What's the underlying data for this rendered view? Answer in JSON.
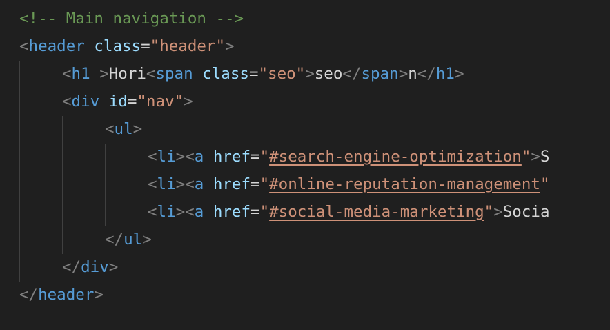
{
  "comment": "<!-- Main navigation -->",
  "lines": [
    {
      "indent": 0,
      "tokens": [
        {
          "t": "<",
          "c": "tag-bracket"
        },
        {
          "t": "header",
          "c": "tag"
        },
        {
          "t": " ",
          "c": "text"
        },
        {
          "t": "class",
          "c": "attr"
        },
        {
          "t": "=",
          "c": "eq"
        },
        {
          "t": "\"header\"",
          "c": "str"
        },
        {
          "t": ">",
          "c": "tag-bracket"
        }
      ]
    },
    {
      "indent": 1,
      "tokens": [
        {
          "t": "<",
          "c": "tag-bracket"
        },
        {
          "t": "h1",
          "c": "tag"
        },
        {
          "t": " ",
          "c": "text"
        },
        {
          "t": ">",
          "c": "tag-bracket"
        },
        {
          "t": "Hori",
          "c": "text"
        },
        {
          "t": "<",
          "c": "tag-bracket"
        },
        {
          "t": "span",
          "c": "tag"
        },
        {
          "t": " ",
          "c": "text"
        },
        {
          "t": "class",
          "c": "attr"
        },
        {
          "t": "=",
          "c": "eq"
        },
        {
          "t": "\"seo\"",
          "c": "str"
        },
        {
          "t": ">",
          "c": "tag-bracket"
        },
        {
          "t": "seo",
          "c": "text"
        },
        {
          "t": "</",
          "c": "tag-bracket"
        },
        {
          "t": "span",
          "c": "tag"
        },
        {
          "t": ">",
          "c": "tag-bracket"
        },
        {
          "t": "n",
          "c": "text"
        },
        {
          "t": "</",
          "c": "tag-bracket"
        },
        {
          "t": "h1",
          "c": "tag"
        },
        {
          "t": ">",
          "c": "tag-bracket"
        }
      ]
    },
    {
      "indent": 1,
      "tokens": [
        {
          "t": "<",
          "c": "tag-bracket"
        },
        {
          "t": "div",
          "c": "tag"
        },
        {
          "t": " ",
          "c": "text"
        },
        {
          "t": "id",
          "c": "attr"
        },
        {
          "t": "=",
          "c": "eq"
        },
        {
          "t": "\"nav\"",
          "c": "str"
        },
        {
          "t": ">",
          "c": "tag-bracket"
        }
      ]
    },
    {
      "indent": 2,
      "tokens": [
        {
          "t": "<",
          "c": "tag-bracket"
        },
        {
          "t": "ul",
          "c": "tag"
        },
        {
          "t": ">",
          "c": "tag-bracket"
        }
      ]
    },
    {
      "indent": 3,
      "tokens": [
        {
          "t": "<",
          "c": "tag-bracket"
        },
        {
          "t": "li",
          "c": "tag"
        },
        {
          "t": ">",
          "c": "tag-bracket"
        },
        {
          "t": "<",
          "c": "tag-bracket"
        },
        {
          "t": "a",
          "c": "tag"
        },
        {
          "t": " ",
          "c": "text"
        },
        {
          "t": "href",
          "c": "attr"
        },
        {
          "t": "=",
          "c": "eq"
        },
        {
          "t": "\"",
          "c": "str"
        },
        {
          "t": "#search-engine-optimization",
          "c": "link"
        },
        {
          "t": "\"",
          "c": "str"
        },
        {
          "t": ">",
          "c": "tag-bracket"
        },
        {
          "t": "S",
          "c": "text"
        }
      ]
    },
    {
      "indent": 3,
      "tokens": [
        {
          "t": "<",
          "c": "tag-bracket"
        },
        {
          "t": "li",
          "c": "tag"
        },
        {
          "t": ">",
          "c": "tag-bracket"
        },
        {
          "t": "<",
          "c": "tag-bracket"
        },
        {
          "t": "a",
          "c": "tag"
        },
        {
          "t": " ",
          "c": "text"
        },
        {
          "t": "href",
          "c": "attr"
        },
        {
          "t": "=",
          "c": "eq"
        },
        {
          "t": "\"",
          "c": "str"
        },
        {
          "t": "#online-reputation-management",
          "c": "link"
        },
        {
          "t": "\"",
          "c": "str"
        }
      ]
    },
    {
      "indent": 3,
      "tokens": [
        {
          "t": "<",
          "c": "tag-bracket"
        },
        {
          "t": "li",
          "c": "tag"
        },
        {
          "t": ">",
          "c": "tag-bracket"
        },
        {
          "t": "<",
          "c": "tag-bracket"
        },
        {
          "t": "a",
          "c": "tag"
        },
        {
          "t": " ",
          "c": "text"
        },
        {
          "t": "href",
          "c": "attr"
        },
        {
          "t": "=",
          "c": "eq"
        },
        {
          "t": "\"",
          "c": "str"
        },
        {
          "t": "#social-media-marketing",
          "c": "link"
        },
        {
          "t": "\"",
          "c": "str"
        },
        {
          "t": ">",
          "c": "tag-bracket"
        },
        {
          "t": "Socia",
          "c": "text"
        }
      ]
    },
    {
      "indent": 2,
      "tokens": [
        {
          "t": "</",
          "c": "tag-bracket"
        },
        {
          "t": "ul",
          "c": "tag"
        },
        {
          "t": ">",
          "c": "tag-bracket"
        }
      ]
    },
    {
      "indent": 1,
      "tokens": [
        {
          "t": "</",
          "c": "tag-bracket"
        },
        {
          "t": "div",
          "c": "tag"
        },
        {
          "t": ">",
          "c": "tag-bracket"
        }
      ]
    },
    {
      "indent": 0,
      "tokens": [
        {
          "t": "</",
          "c": "tag-bracket"
        },
        {
          "t": "header",
          "c": "tag"
        },
        {
          "t": ">",
          "c": "tag-bracket"
        }
      ]
    }
  ]
}
